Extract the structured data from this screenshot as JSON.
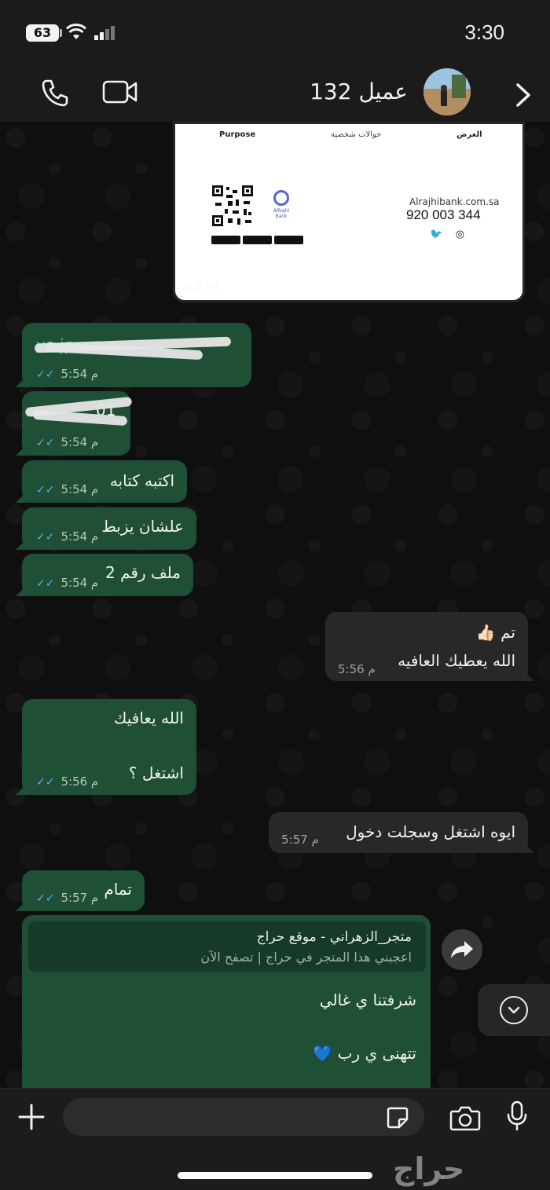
{
  "status_bar": {
    "battery": "63",
    "time": "3:30"
  },
  "header": {
    "contact_name": "عميل 132"
  },
  "image_message": {
    "card": {
      "purpose_en": "Purpose",
      "transfers_ar": "حوالات شخصية",
      "purpose_ar": "الغرض",
      "bank_name": "AlRajhi Bank",
      "website": "Alrajhibank.com.sa",
      "phone": "920 003 344"
    },
    "time": "5:54 م"
  },
  "messages": [
    {
      "text": "vo.jp",
      "time": "5:54 م"
    },
    {
      "text": "01",
      "time": "5:54 م"
    },
    {
      "text": "اكتبه كتابه",
      "time": "5:54 م"
    },
    {
      "text": "علشان يزبط",
      "time": "5:54 م"
    },
    {
      "text": "ملف رقم 2",
      "time": "5:54 م"
    },
    {
      "line1": "تم 👍🏻",
      "line2": "الله يعطيك العافيه",
      "time": "5:56 م"
    },
    {
      "line1": "الله يعافيك",
      "line2": "اشتغل ؟",
      "time": "5:56 م"
    },
    {
      "text": "ايوه اشتغل وسجلت دخول",
      "time": "5:57 م"
    },
    {
      "text": "تمام",
      "time": "5:57 م"
    },
    {
      "preview_title": "متجر_الزهراني - موقع حراج",
      "preview_sub": "اعجبني هذا المتجر في حراج | تصفح الآن",
      "line1": "شرفتنا ي غالي",
      "line2": "تتهنى ي رب 💙"
    }
  ],
  "input": {
    "placeholder": ""
  },
  "watermark": "حراج",
  "colors": {
    "outgoing": "#1f4f34",
    "incoming": "#282828",
    "tick": "#56b1f0",
    "link": "#4bc27a"
  }
}
